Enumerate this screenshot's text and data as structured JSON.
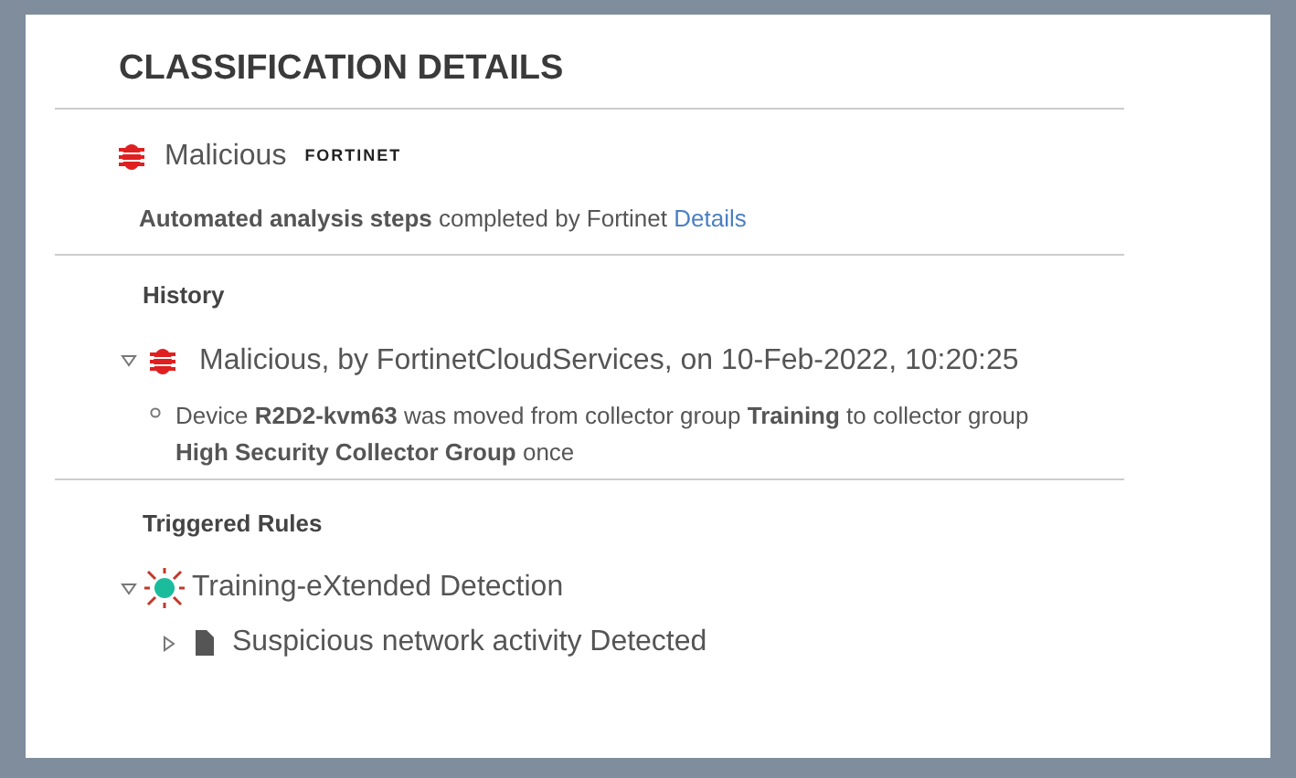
{
  "title": "CLASSIFICATION DETAILS",
  "classification": {
    "verdict": "Malicious",
    "vendor_logo": "FORTINET",
    "summary": "**Automated analysis steps** completed by Fortinet",
    "link": "Details"
  },
  "history": {
    "heading": "History",
    "entries": [
      {
        "text": "Malicious, by FortinetCloudServices, on 10-Feb-2022, 10:20:25",
        "expanded": true,
        "children": [
          {
            "text": "Device **R2D2-kvm63** was moved from collector group **Training** to collector group **High Security Collector Group** once"
          }
        ]
      }
    ]
  },
  "triggered_rules": {
    "heading": "Triggered Rules",
    "rules": [
      {
        "text": "Training-eXtended Detection",
        "expanded": true,
        "children": [
          {
            "text": "Suspicious network activity Detected",
            "expanded": false
          }
        ]
      }
    ]
  }
}
